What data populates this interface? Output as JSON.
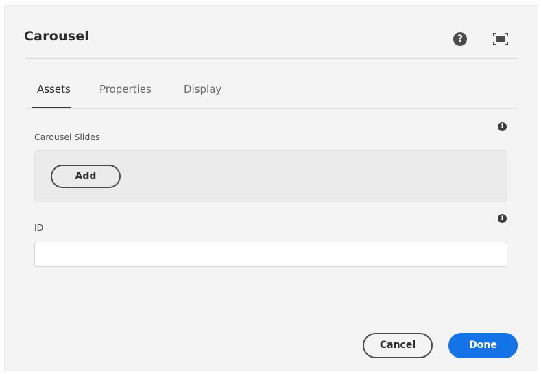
{
  "dialog": {
    "title": "Carousel",
    "help_icon": "question-circle-icon",
    "fullscreen_icon": "fullscreen-icon"
  },
  "tabs": [
    {
      "label": "Assets",
      "active": true
    },
    {
      "label": "Properties",
      "active": false
    },
    {
      "label": "Display",
      "active": false
    }
  ],
  "carousel_slides": {
    "label": "Carousel Slides",
    "info_icon": "info-icon",
    "add_label": "Add"
  },
  "id_field": {
    "label": "ID",
    "value": "",
    "placeholder": "",
    "info_icon": "info-icon"
  },
  "footer": {
    "cancel_label": "Cancel",
    "done_label": "Done"
  },
  "colors": {
    "primary": "#1473e6",
    "background": "#f4f4f4",
    "text": "#2c2c2c"
  }
}
